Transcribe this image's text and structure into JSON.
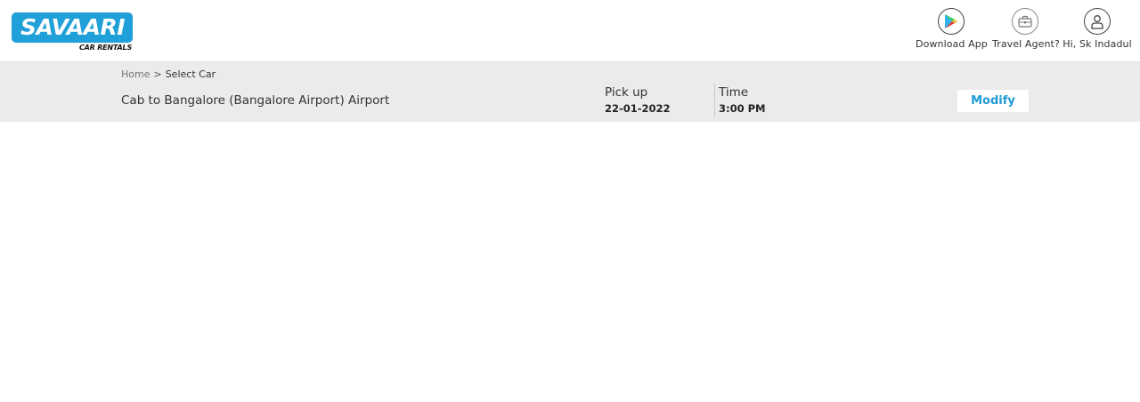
{
  "brand": {
    "name": "SAVAARI",
    "tagline": "CAR RENTALS",
    "color": "#1fa0d8"
  },
  "nav": {
    "download_app": {
      "label": "Download App",
      "icon": "play-store-icon"
    },
    "travel_agent": {
      "label": "Travel Agent?",
      "icon": "briefcase-icon"
    },
    "user": {
      "label": "Hi, Sk Indadul",
      "icon": "user-icon"
    }
  },
  "breadcrumb": {
    "home": "Home",
    "separator": ">",
    "current": "Select Car"
  },
  "trip": {
    "title": "Cab to Bangalore (Bangalore Airport) Airport",
    "pickup_label": "Pick up",
    "pickup_date": "22-01-2022",
    "time_label": "Time",
    "time_value": "3:00 PM"
  },
  "actions": {
    "modify_label": "Modify",
    "accent_color": "#1d9ad6"
  }
}
